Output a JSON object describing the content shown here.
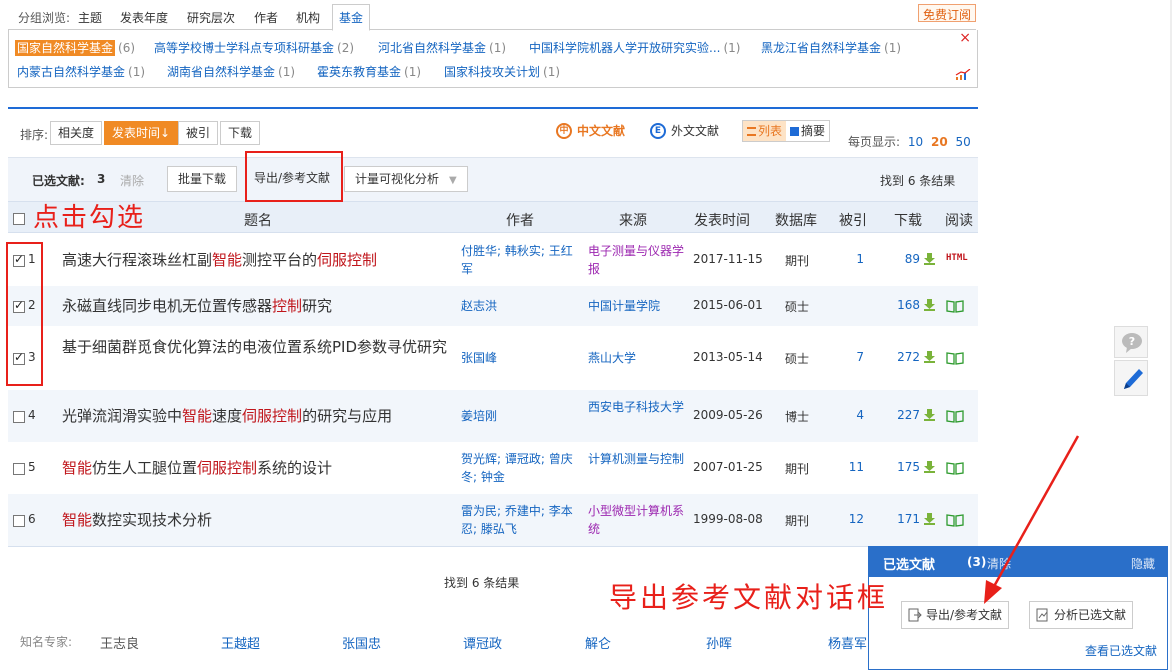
{
  "group_bar": {
    "label": "分组浏览:",
    "tabs": [
      "主题",
      "发表年度",
      "研究层次",
      "作者",
      "机构",
      "基金"
    ],
    "active_tab": "基金",
    "free_subscribe": "免费订阅"
  },
  "funds": [
    {
      "name": "国家自然科学基金",
      "count": "(6)",
      "selected": true
    },
    {
      "name": "高等学校博士学科点专项科研基金",
      "count": "(2)"
    },
    {
      "name": "河北省自然科学基金",
      "count": "(1)"
    },
    {
      "name": "中国科学院机器人学开放研究实验...",
      "count": "(1)"
    },
    {
      "name": "黑龙江省自然科学基金",
      "count": "(1)"
    },
    {
      "name": "内蒙古自然科学基金",
      "count": "(1)"
    },
    {
      "name": "湖南省自然科学基金",
      "count": "(1)"
    },
    {
      "name": "霍英东教育基金",
      "count": "(1)"
    },
    {
      "name": "国家科技攻关计划",
      "count": "(1)"
    }
  ],
  "sort_bar": {
    "label": "排序:",
    "options": [
      "相关度",
      "发表时间",
      "被引",
      "下载"
    ],
    "active": "发表时间",
    "chinese_docs": "中文文献",
    "foreign_docs": "外文文献",
    "view_list": "列表",
    "view_abstract": "摘要",
    "per_page_label": "每页显示:",
    "per_page_options": [
      "10",
      "20",
      "50"
    ],
    "per_page_active": "20"
  },
  "selection_bar": {
    "label": "已选文献:",
    "count": "3",
    "clear": "清除",
    "batch_download": "批量下载",
    "export": "导出/参考文献",
    "visualize": "计量可视化分析",
    "found": "找到 6 条结果"
  },
  "table": {
    "headers": [
      "题名",
      "作者",
      "来源",
      "发表时间",
      "数据库",
      "被引",
      "下载",
      "阅读"
    ],
    "rows": [
      {
        "idx": "1",
        "checked": true,
        "title_parts": [
          [
            "高速大行程滚珠丝杠副",
            false
          ],
          [
            "智能",
            true
          ],
          [
            "测控平台的",
            false
          ],
          [
            "伺服控制",
            true
          ]
        ],
        "author": "付胜华; 韩秋实; 王红军",
        "source": "电子测量与仪器学报",
        "source_purple": true,
        "date": "2017-11-15",
        "db": "期刊",
        "cited": "1",
        "downloads": "89",
        "read": "HTML"
      },
      {
        "idx": "2",
        "checked": true,
        "title_parts": [
          [
            "永磁直线同步电机无位置传感器",
            false
          ],
          [
            "控制",
            true
          ],
          [
            "研究",
            false
          ]
        ],
        "author": "赵志洪",
        "source": "中国计量学院",
        "source_purple": false,
        "date": "2015-06-01",
        "db": "硕士",
        "cited": "",
        "downloads": "168",
        "read": "book"
      },
      {
        "idx": "3",
        "checked": true,
        "title_parts": [
          [
            "基于细菌群觅食优化算法的电液位置系统PID参数寻优研究",
            false
          ]
        ],
        "author": "张国峰",
        "source": "燕山大学",
        "source_purple": false,
        "date": "2013-05-14",
        "db": "硕士",
        "cited": "7",
        "downloads": "272",
        "read": "book"
      },
      {
        "idx": "4",
        "checked": false,
        "title_parts": [
          [
            "光弹流润滑实验中",
            false
          ],
          [
            "智能",
            true
          ],
          [
            "速度",
            false
          ],
          [
            "伺服控制",
            true
          ],
          [
            "的研究与应用",
            false
          ]
        ],
        "author": "姜培刚",
        "source": "西安电子科技大学",
        "source_purple": false,
        "date": "2009-05-26",
        "db": "博士",
        "cited": "4",
        "downloads": "227",
        "read": "book"
      },
      {
        "idx": "5",
        "checked": false,
        "title_parts": [
          [
            "智能",
            true
          ],
          [
            "仿生人工腿位置",
            false
          ],
          [
            "伺服控制",
            true
          ],
          [
            "系统的设计",
            false
          ]
        ],
        "author": "贺光辉; 谭冠政; 曾庆冬; 钟金",
        "source": "计算机测量与控制",
        "source_purple": false,
        "date": "2007-01-25",
        "db": "期刊",
        "cited": "11",
        "downloads": "175",
        "read": "book"
      },
      {
        "idx": "6",
        "checked": false,
        "title_parts": [
          [
            "智能",
            true
          ],
          [
            "数控实现技术分析",
            false
          ]
        ],
        "author": "雷为民; 乔建中; 李本忍; 滕弘飞",
        "source": "小型微型计算机系统",
        "source_purple": true,
        "date": "1999-08-08",
        "db": "期刊",
        "cited": "12",
        "downloads": "171",
        "read": "book"
      }
    ]
  },
  "found_bottom": "找到 6 条结果",
  "experts": {
    "label": "知名专家:",
    "names": [
      "王志良",
      "王越超",
      "张国忠",
      "谭冠政",
      "解仑",
      "孙晖",
      "杨喜军"
    ]
  },
  "selected_panel": {
    "title": "已选文献",
    "count": "(3)",
    "clear": "清除",
    "hide": "隐藏",
    "export": "导出/参考文献",
    "analyze": "分析已选文献",
    "view_selected": "查看已选文献"
  },
  "annotations": {
    "click_check": "点击勾选",
    "export_dialog": "导出参考文献对话框"
  },
  "colors": {
    "accent_orange": "#f08a24",
    "link_blue": "#1565c0",
    "highlight_red": "#c0151b",
    "annotation_red": "#e8201a",
    "panel_blue": "#2a6fc9"
  }
}
